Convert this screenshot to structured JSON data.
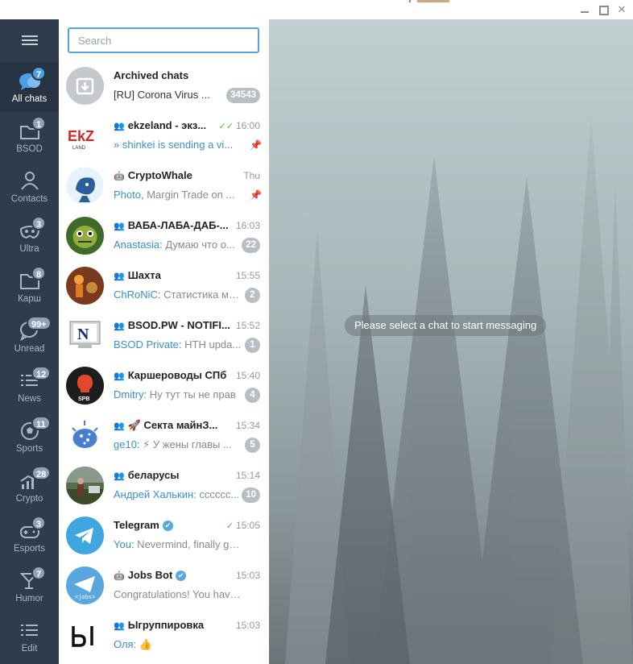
{
  "window": {
    "minimize_icon": "minimize-icon",
    "maximize_icon": "maximize-icon",
    "close_icon": "close-icon",
    "close_glyph": "✕"
  },
  "sidebar": {
    "folders": [
      {
        "label": "All chats",
        "badge": "7",
        "icon": "chat-bubbles-icon",
        "active": true
      },
      {
        "label": "BSOD",
        "badge": "1",
        "icon": "folder-icon"
      },
      {
        "label": "Contacts",
        "badge": "",
        "icon": "person-icon"
      },
      {
        "label": "Ultra",
        "badge": "3",
        "icon": "mask-icon"
      },
      {
        "label": "Карш",
        "badge": "8",
        "icon": "folder-icon"
      },
      {
        "label": "Unread",
        "badge": "99+",
        "icon": "chat-bubble-icon"
      },
      {
        "label": "News",
        "badge": "12",
        "icon": "list-icon"
      },
      {
        "label": "Sports",
        "badge": "11",
        "icon": "soccer-ball-icon"
      },
      {
        "label": "Crypto",
        "badge": "28",
        "icon": "chart-icon"
      },
      {
        "label": "Esports",
        "badge": "3",
        "icon": "gamepad-icon"
      },
      {
        "label": "Humor",
        "badge": "7",
        "icon": "cocktail-icon"
      },
      {
        "label": "Edit",
        "badge": "",
        "icon": "edit-list-icon"
      }
    ]
  },
  "search": {
    "placeholder": "Search"
  },
  "chats": [
    {
      "name": "Archived chats",
      "time": "",
      "sender": "",
      "preview": "[RU] Corona Virus ...",
      "unread": "34543",
      "type": "archive",
      "muted": true
    },
    {
      "name": "ekzeland - экз...",
      "time": "16:00",
      "sender": "",
      "preview": "shinkei is sending a vi...",
      "unread": "",
      "pinned": true,
      "group": true,
      "read": "✓✓"
    },
    {
      "name": "CryptoWhale",
      "time": "Thu",
      "sender": "Photo,",
      "preview": " Margin Trade on ...",
      "unread": "",
      "pinned": true,
      "bot": true
    },
    {
      "name": "ВАБА-ЛАБА-ДАБ-...",
      "time": "16:03",
      "sender": "Anastasia:",
      "preview": " Думаю что о...",
      "unread": "22",
      "group": true
    },
    {
      "name": "Шахта",
      "time": "15:55",
      "sender": "ChRoNiC:",
      "preview": " Статистика мо...",
      "unread": "2",
      "group": true
    },
    {
      "name": "BSOD.PW - NOTIFI...",
      "time": "15:52",
      "sender": "BSOD Private:",
      "preview": " HTH upda...",
      "unread": "1",
      "group": true
    },
    {
      "name": "Каршероводы СПб",
      "time": "15:40",
      "sender": "Dmitry:",
      "preview": " Ну тут ты не прав",
      "unread": "4",
      "group": true
    },
    {
      "name": "🚀 Секта майнЗ...",
      "time": "15:34",
      "sender": "ge10:",
      "preview": " ⚡ У жены главы ...",
      "unread": "5",
      "group": true
    },
    {
      "name": "беларусы",
      "time": "15:14",
      "sender": "Андрей Халькин:",
      "preview": " сссссс...",
      "unread": "10",
      "group": true
    },
    {
      "name": "Telegram",
      "time": "15:05",
      "sender": "You:",
      "preview": " Nevermind, finally got t...",
      "unread": "",
      "verified": true,
      "read": "✓"
    },
    {
      "name": "Jobs Bot",
      "time": "15:03",
      "sender": "",
      "preview": "Congratulations! You have b...",
      "unread": "",
      "verified": true,
      "bot": true
    },
    {
      "name": "Ыгруппировка",
      "time": "15:03",
      "sender": "Оля:",
      "preview": " 👍",
      "unread": "",
      "group": true
    }
  ],
  "main": {
    "empty_message": "Please select a chat to start messaging"
  },
  "colors": {
    "sidebar": "#2f3c4b",
    "accent": "#54a3dc",
    "badge_muted": "#b8bec4"
  }
}
